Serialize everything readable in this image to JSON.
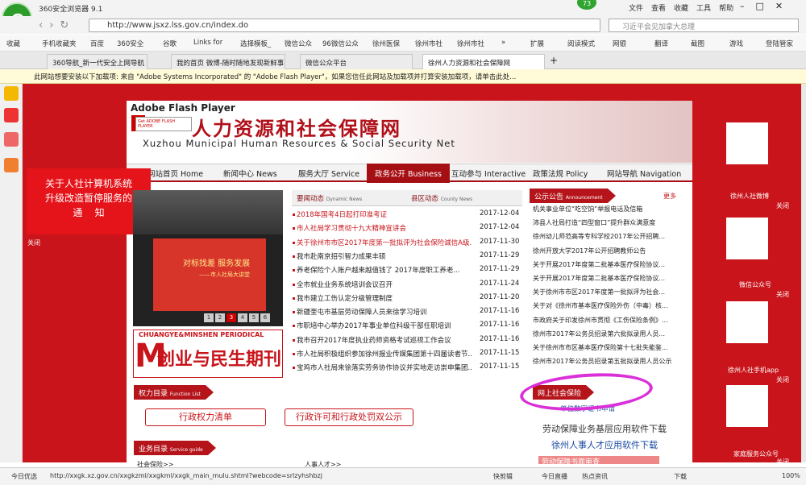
{
  "browser": {
    "title": "360安全浏览器 9.1",
    "menu": [
      "文件",
      "查看",
      "收藏",
      "工具",
      "帮助"
    ],
    "badge": "73",
    "url": "http://www.jsxz.lss.gov.cn/index.do",
    "search_placeholder": "习近平会见加拿大总理"
  },
  "favorites": [
    "收藏",
    "手机收藏夹",
    "百度",
    "360安全",
    "谷歌",
    "Links for",
    "选择模板_",
    "微信公众",
    "96微信公众",
    "徐州医保",
    "徐州市社",
    "徐州市社",
    "»",
    "扩展",
    "阅读模式",
    "网银",
    "翻译",
    "截图",
    "游戏",
    "登陆管家"
  ],
  "tabs": [
    {
      "label": "360导航_新一代安全上网导航"
    },
    {
      "label": "我的首页 微博-随时随地发现新鲜事"
    },
    {
      "label": "微信公众平台"
    },
    {
      "label": "徐州人力资源和社会保障网",
      "active": true
    }
  ],
  "flash_notice": "此网站想要安装以下加载项: 来自 \"Adobe Systems Incorporated\" 的 \"Adobe Flash Player\"，如果您信任此网站及加载项并打算安装加载项，请单击此处...",
  "site": {
    "flash_label": "Adobe Flash Player",
    "get_flash": "Get ADOBE FLASH PLAYER",
    "title_cn": "人力资源和社会保障网",
    "title_en": "Xuzhou Municipal Human Resources & Social Security Net"
  },
  "nav": [
    {
      "label": "网站首页 Home"
    },
    {
      "label": "新闻中心 News"
    },
    {
      "label": "服务大厅 Service"
    },
    {
      "label": "政务公开 Business",
      "active": true
    },
    {
      "label": "互动参与 Interactive"
    },
    {
      "label": "政策法规 Policy"
    },
    {
      "label": "网站导航 Navigation"
    }
  ],
  "notice": {
    "lines": [
      "关于人社计算机系统",
      "升级改造暂停服务的",
      "通    知"
    ],
    "close": "关闭"
  },
  "slide": {
    "banner": "对标找差 服务发展",
    "banner_sub": "——市人社局大讲堂",
    "pages": [
      "1",
      "2",
      "3",
      "4",
      "5",
      "6"
    ],
    "active_page": "3"
  },
  "periodical": {
    "en": "CHUANGYE&MINSHEN PERIODICAL",
    "m": "M",
    "cn": "创业与民生期刊"
  },
  "news_tabs": [
    {
      "label": "要闻动态",
      "sub": "Dynamic News"
    },
    {
      "label": "县区动态",
      "sub": "County News"
    }
  ],
  "news": [
    {
      "title": "2018年国考4日起打印准考证",
      "date": "2017-12-04",
      "red": true
    },
    {
      "title": "市人社局学习贯彻十九大精神宣讲会",
      "date": "2017-12-04",
      "red": true
    },
    {
      "title": "关于徐州市市区2017年度第一批拟评为社会保险诚信A级...",
      "date": "2017-11-30",
      "red": true
    },
    {
      "title": "我市赴南京招引智力成果丰硕",
      "date": "2017-11-29",
      "red": false
    },
    {
      "title": "养老保险个人账户越来越值钱了 2017年度职工养老...",
      "date": "2017-11-29",
      "red": false
    },
    {
      "title": "全市就业业务系统培训会议召开",
      "date": "2017-11-24",
      "red": false
    },
    {
      "title": "我市建立工伤认定分级管理制度",
      "date": "2017-11-20",
      "red": false
    },
    {
      "title": "新疆奎屯市基层劳动保障人员来徐学习培训",
      "date": "2017-11-16",
      "red": false
    },
    {
      "title": "市职培中心举办2017年事业单位科级干部任职培训",
      "date": "2017-11-16",
      "red": false
    },
    {
      "title": "我市召开2017年度执业药师资格考试巡视工作会议",
      "date": "2017-11-16",
      "red": false
    },
    {
      "title": "市人社局积极组织参加徐州报业传媒集团第十四届读者节...",
      "date": "2017-11-15",
      "red": false
    },
    {
      "title": "宝鸡市人社局来徐落实劳务协作协议并实地走访崇申集团...",
      "date": "2017-11-15",
      "red": false
    }
  ],
  "announcements": {
    "title": "公示公告",
    "sub": "Announcement",
    "more": "更多",
    "items": [
      "机关事业单位“吃空饷”举报电话及信箱",
      "沛县人社局打造“四型窗口”提升群众满意度",
      "徐州幼儿师范高等专科学校2017年公开招聘...",
      "徐州开放大学2017年公开招聘教师公告",
      "关于开展2017年度第二批基本医疗保险协议...",
      "关于开展2017年度第二批基本医疗保险协议...",
      "关于徐州市市区2017年度第一批拟评为社会...",
      "关于对《徐州市基本医疗保险外伤（中毒）核...",
      "市政府关于印发徐州市贯彻《工伤保险条例》...",
      "徐州市2017年公务员招录第六批拟录用人员...",
      "关于徐州市市区基本医疗保险第十七批失能鉴...",
      "徐州市2017年公务员招录第五批拟录用人员公示"
    ]
  },
  "online_social": {
    "title": "网上社会保险",
    "sub": "单位数字证书申请"
  },
  "downloads": [
    "劳动保障业务基层应用软件下载",
    "徐州人事人才应用软件下载"
  ],
  "function_list": {
    "title": "权力目录",
    "sub": "Function List",
    "buttons": [
      "行政权力清单",
      "行政许可和行政处罚双公示"
    ]
  },
  "service_guide": {
    "title": "业务目录",
    "sub": "Service guide",
    "row": [
      "社会保险>>",
      "人事人才>>"
    ]
  },
  "labor_box": "劳动保障书面审查",
  "qr": [
    {
      "label": "徐州人社微博",
      "close": "关闭"
    },
    {
      "label": "微信公众号",
      "close": "关闭"
    },
    {
      "label": "徐州人社手机app",
      "close": "关闭"
    },
    {
      "label": "家庭服务公众号",
      "close": "关闭"
    }
  ],
  "status": {
    "left": "今日优选",
    "url": "http://xxgk.xz.gov.cn/xxgkzml/xxgkml/xxgk_main_mulu.shtml?webcode=srlzyhshbzj",
    "items": [
      "快剪辑",
      "今日直播",
      "热点资讯",
      "下载",
      "100%"
    ]
  },
  "colors": {
    "site_red": "#c8141a",
    "highlight": "#d930d9"
  }
}
